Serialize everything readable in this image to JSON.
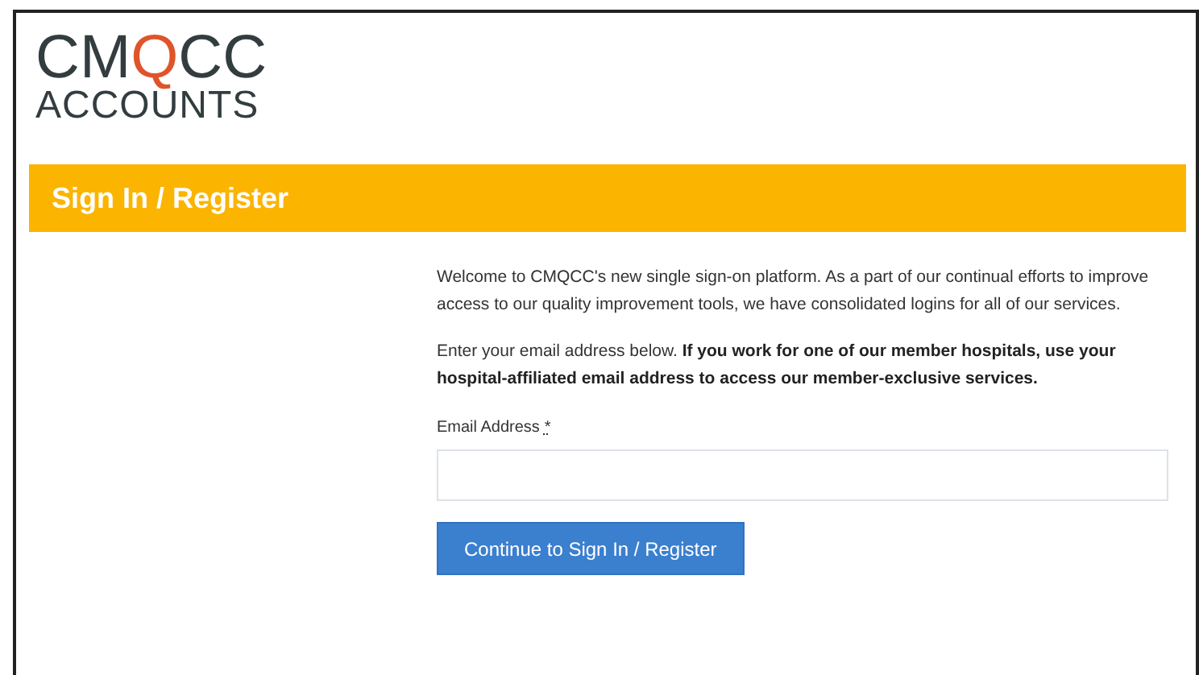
{
  "logo": {
    "wordmark": [
      {
        "text": "CM",
        "accent": false
      },
      {
        "text": "Q",
        "accent": true
      },
      {
        "text": "CC",
        "accent": false
      }
    ],
    "subtitle": "ACCOUNTS"
  },
  "header": {
    "title": "Sign In / Register"
  },
  "intro": [
    "Welcome to CMQCC's new single sign-on platform. As a part of our continual efforts to improve access to our quality improvement tools, we have consolidated logins for all of our services.",
    "Enter your email address below. **If you work for one of our member hospitals, use your hospital-affiliated email address to access our member-exclusive services.**"
  ],
  "email_field": {
    "label": "Email Address",
    "required_mark": "*"
  },
  "submit_button": {
    "label": "Continue to Sign In / Register"
  }
}
